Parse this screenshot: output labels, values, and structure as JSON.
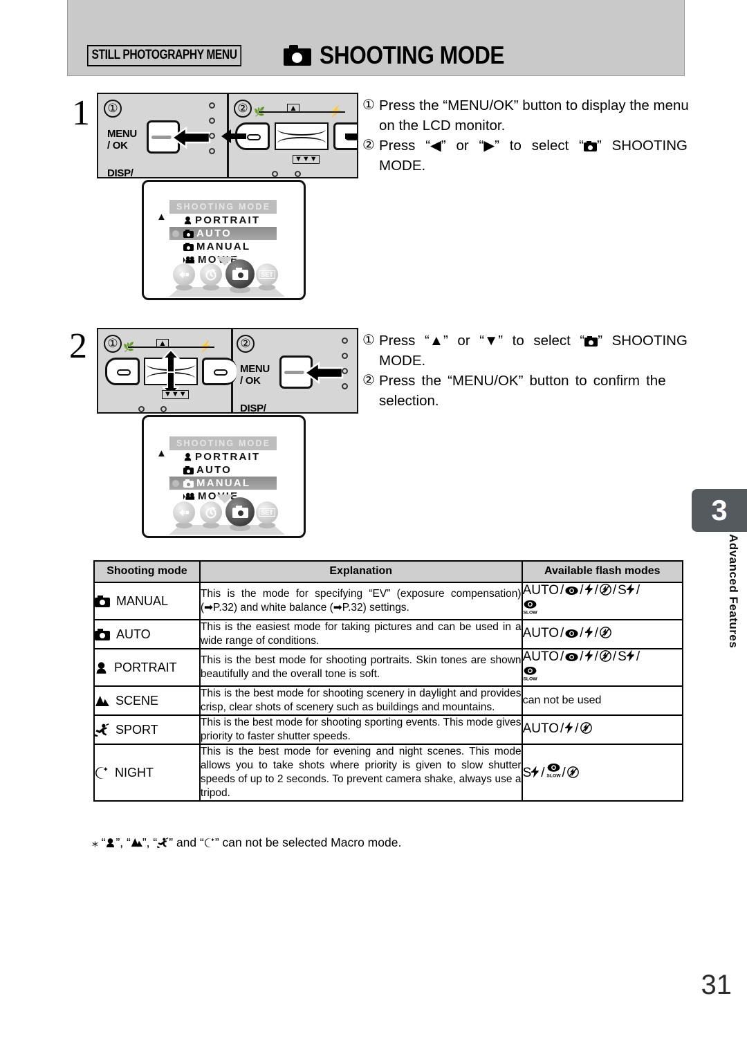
{
  "header": {
    "tag": "STILL PHOTOGRAPHY MENU",
    "icon": "camera-icon",
    "title": "SHOOTING MODE"
  },
  "steps": [
    {
      "number": "1",
      "callout_1": "①",
      "callout_2": "②",
      "camera_labels": {
        "menu_ok": "MENU\n/ OK",
        "disp": "DISP/"
      },
      "instructions": [
        {
          "marker": "①",
          "lines": [
            "Press the “MENU/OK” button to display the menu",
            "on the LCD monitor."
          ]
        },
        {
          "marker": "②",
          "lines": [
            "Press “◀” or “▶” to select “📷” SHOOTING",
            "MODE."
          ]
        }
      ],
      "lcd": {
        "title": "SHOOTING MODE",
        "up_arrow": "▲",
        "items": [
          {
            "icon": "portrait-icon",
            "label": "PORTRAIT",
            "selected": false,
            "bullet": false
          },
          {
            "icon": "camera-icon",
            "label": "AUTO",
            "selected": true,
            "bullet": true
          },
          {
            "icon": "camera-icon",
            "label": "MANUAL",
            "selected": false,
            "bullet": false
          },
          {
            "icon": "movie-icon",
            "label": "MOVIE",
            "selected": false,
            "bullet": false
          }
        ],
        "toolbar": [
          {
            "icon": "back-icon",
            "label": "",
            "active": false
          },
          {
            "icon": "timer-icon",
            "label": "",
            "active": false
          },
          {
            "icon": "camera-icon",
            "label": "",
            "active": true
          },
          {
            "icon": "set-icon",
            "label": "SET",
            "active": false
          }
        ]
      }
    },
    {
      "number": "2",
      "callout_1": "①",
      "callout_2": "②",
      "camera_labels": {
        "menu_ok": "MENU\n/ OK",
        "disp": "DISP/"
      },
      "instructions": [
        {
          "marker": "①",
          "lines": [
            "Press “▲” or “▼” to select “📷” SHOOTING",
            "MODE."
          ]
        },
        {
          "marker": "②",
          "lines": [
            "Press the “MENU/OK” button to confirm the",
            "selection."
          ]
        }
      ],
      "lcd": {
        "title": "SHOOTING MODE",
        "up_arrow": "▲",
        "items": [
          {
            "icon": "portrait-icon",
            "label": "PORTRAIT",
            "selected": false,
            "bullet": false
          },
          {
            "icon": "camera-icon",
            "label": "AUTO",
            "selected": false,
            "bullet": false
          },
          {
            "icon": "camera-icon",
            "label": "MANUAL",
            "selected": true,
            "bullet": true
          },
          {
            "icon": "movie-icon",
            "label": "MOVIE",
            "selected": false,
            "bullet": false
          }
        ],
        "toolbar": [
          {
            "icon": "back-icon",
            "label": "",
            "active": false
          },
          {
            "icon": "timer-icon",
            "label": "",
            "active": false
          },
          {
            "icon": "camera-icon",
            "label": "",
            "active": true
          },
          {
            "icon": "set-icon",
            "label": "SET",
            "active": false
          }
        ]
      }
    }
  ],
  "table": {
    "headers": [
      "Shooting mode",
      "Explanation",
      "Available flash modes"
    ],
    "rows": [
      {
        "mode_icon": "camera-icon",
        "mode": "MANUAL",
        "explanation": "This is the mode for specifying “EV” (exposure compensation) (➡P.32) and white balance (➡P.32) settings.",
        "flash": "AUTO / ◉ / ⚡ / ⚡⃠ / S⚡ / ◉SLOW"
      },
      {
        "mode_icon": "camera-icon",
        "mode": "AUTO",
        "explanation": "This is the easiest mode for taking pictures and can be used in a wide range of conditions.",
        "flash": "AUTO / ◉ / ⚡ / ⚡⃠"
      },
      {
        "mode_icon": "portrait-icon",
        "mode": "PORTRAIT",
        "explanation": "This is the best mode for shooting portraits. Skin tones are shown beautifully and the overall tone is soft.",
        "flash": "AUTO / ◉ / ⚡ / ⚡⃠ / S⚡ / ◉SLOW"
      },
      {
        "mode_icon": "mountain-icon",
        "mode": "SCENE",
        "explanation": "This is the best mode for shooting scenery in daylight and provides crisp, clear shots of scenery such as buildings and mountains.",
        "flash": "can not be used"
      },
      {
        "mode_icon": "sport-icon",
        "mode": "SPORT",
        "explanation": "This is the best mode for shooting sporting events. This mode gives priority to faster shutter speeds.",
        "flash": "AUTO / ⚡ / ⚡⃠"
      },
      {
        "mode_icon": "moon-icon",
        "mode": "NIGHT",
        "explanation": "This is the best mode for evening and night scenes. This mode allows you to take shots where priority is given to slow shutter speeds of up to 2 seconds. To prevent camera shake, always use a tripod.",
        "flash": "S⚡ / ◉SLOW / ⚡⃠"
      }
    ]
  },
  "footnote": "※ “👤”, “▲”, “🏃” and “☽” can not be selected Macro mode.",
  "side_tab": {
    "number": "3",
    "label": "Advanced Features"
  },
  "page_number": "31",
  "colors": {
    "header_bg": "#c9c9c9",
    "camera_body": "#d6d6d6",
    "table_header_bg": "#cfcfcf",
    "side_tab_bg": "#555a5e",
    "lcd_selected": "#8c8c8c"
  }
}
